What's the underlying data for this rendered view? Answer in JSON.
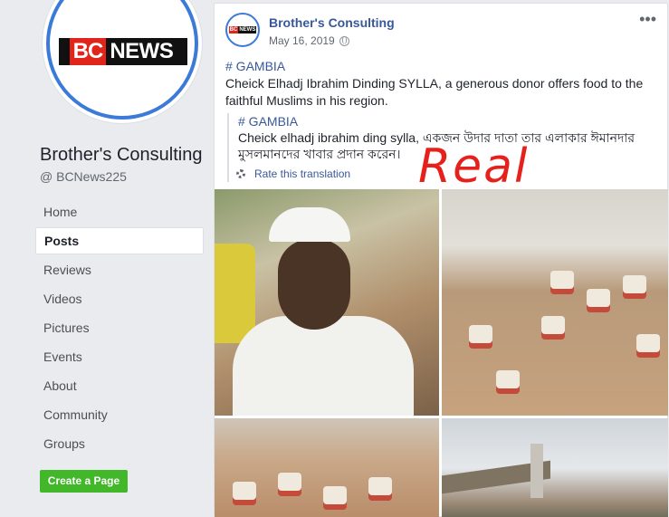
{
  "sidebar": {
    "logo": {
      "left": "BC",
      "right": "NEWS"
    },
    "page_name": "Brother's Consulting",
    "handle": "@ BCNews225",
    "nav": [
      {
        "label": "Home",
        "active": false
      },
      {
        "label": "Posts",
        "active": true
      },
      {
        "label": "Reviews",
        "active": false
      },
      {
        "label": "Videos",
        "active": false
      },
      {
        "label": "Pictures",
        "active": false
      },
      {
        "label": "Events",
        "active": false
      },
      {
        "label": "About",
        "active": false
      },
      {
        "label": "Community",
        "active": false
      },
      {
        "label": "Groups",
        "active": false
      }
    ],
    "create_button": "Create a Page"
  },
  "post": {
    "author": "Brother's Consulting",
    "date": "May 16, 2019",
    "privacy_icon": "globe-icon",
    "more_icon": "more-options-icon",
    "hashtag": "# GAMBIA",
    "text": "Cheick Elhadj Ibrahim Dinding SYLLA, a generous donor offers food to the faithful Muslims in his region.",
    "translation": {
      "hashtag": "# GAMBIA",
      "text": "Cheick elhadj ibrahim ding sylla, একজন উদার দাতা তার এলাকার ঈমানদার মুসলমানদের খাবার প্রদান করেন।",
      "rate_label": "Rate this translation"
    },
    "overlay_label": "Real"
  },
  "colors": {
    "link": "#385898",
    "brand_red": "#e1251b",
    "overlay_red": "#e6201a",
    "create_green": "#42b72a",
    "ring_blue": "#3c7ad9"
  }
}
